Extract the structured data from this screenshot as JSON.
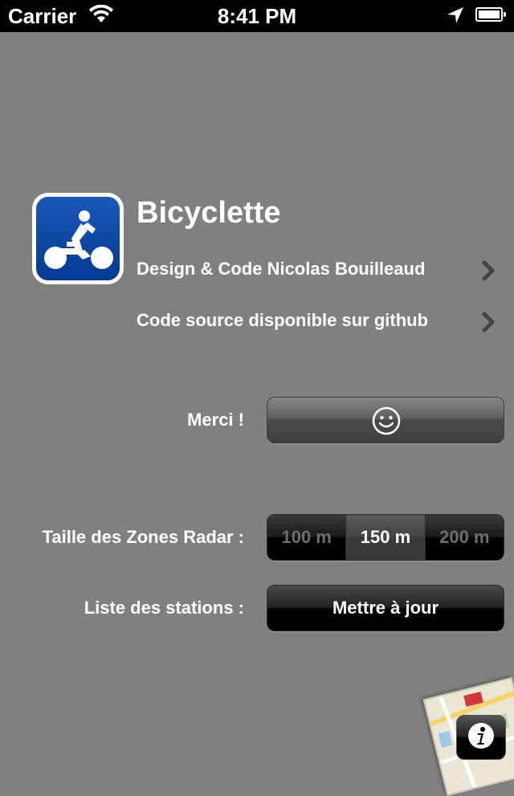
{
  "status_bar": {
    "carrier": "Carrier",
    "time": "8:41 PM"
  },
  "app": {
    "title": "Bicyclette",
    "links": [
      {
        "label": "Design & Code Nicolas Bouilleaud"
      },
      {
        "label": "Code source disponible sur github"
      }
    ]
  },
  "thanks": {
    "label": "Merci !",
    "button_icon": "smiley-icon"
  },
  "radar": {
    "label": "Taille des Zones Radar :",
    "options": [
      "100 m",
      "150 m",
      "200 m"
    ],
    "selected": "150 m"
  },
  "stations": {
    "label": "Liste des stations :",
    "button_label": "Mettre à jour"
  },
  "info_button": {
    "icon": "info-icon"
  },
  "colors": {
    "background": "#808080",
    "app_icon": "#0a4aa6"
  }
}
